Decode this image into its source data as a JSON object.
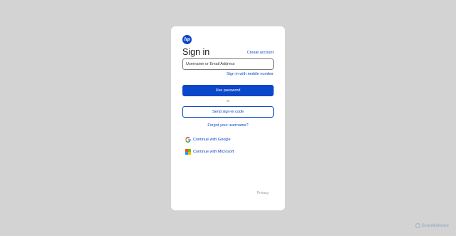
{
  "logo": {
    "text": "hp",
    "color": "#0b47c9"
  },
  "signin": {
    "title": "Sign in",
    "create_account": "Create account",
    "username_placeholder": "Username or Email Address",
    "mobile_link": "Sign in with mobile number",
    "use_password": "Use password",
    "or": "or",
    "send_code": "Send sign-in code",
    "forgot_username": "Forgot your username?",
    "google": "Continue with Google",
    "microsoft": "Continue with Microsoft",
    "privacy": "Privacy"
  },
  "watermark": {
    "text": "ScanMalware"
  },
  "colors": {
    "accent": "#0b47c9",
    "background": "#d3d3d3",
    "card": "#ffffff",
    "ms_red": "#f25022",
    "ms_green": "#7fba00",
    "ms_blue": "#00a4ef",
    "ms_yellow": "#ffb900"
  },
  "icons": [
    "hp-logo-icon",
    "google-icon",
    "microsoft-icon",
    "scanmalware-logo-icon"
  ]
}
